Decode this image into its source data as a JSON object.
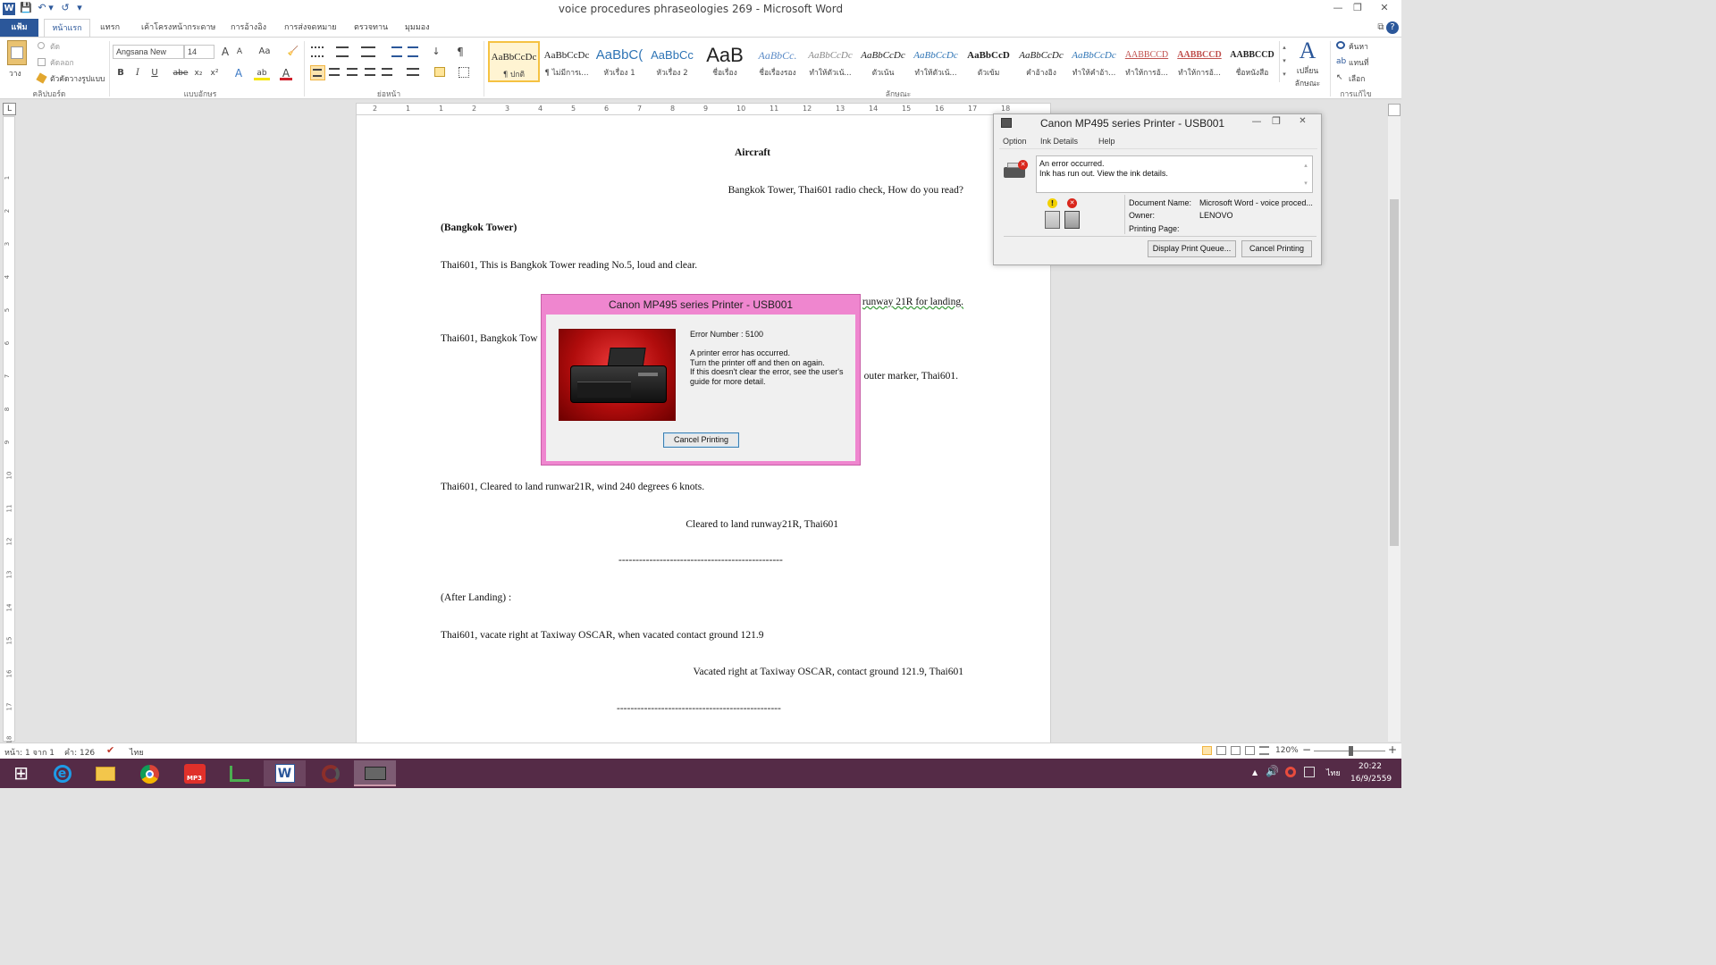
{
  "app": {
    "title": "voice procedures phraseologies 269 - Microsoft Word",
    "qat": {
      "word": "W",
      "save": "💾",
      "undo": "↶",
      "undo_dd": "▾",
      "redo": "↺",
      "customize": "▾"
    },
    "window_controls": {
      "help": "?",
      "restore_ribbon": "⧉",
      "minimize": "—",
      "maximize": "❐",
      "close": "✕"
    }
  },
  "tabs": [
    "แฟ้ม",
    "หน้าแรก",
    "แทรก",
    "เค้าโครงหน้ากระดาษ",
    "การอ้างอิง",
    "การส่งจดหมาย",
    "ตรวจทาน",
    "มุมมอง"
  ],
  "ribbon": {
    "clipboard": {
      "label": "คลิปบอร์ด",
      "paste": "วาง",
      "cut": "ตัด",
      "copy": "คัดลอก",
      "format_painter": "ตัวคัดวางรูปแบบ"
    },
    "font": {
      "label": "แบบอักษร",
      "font_name": "Angsana New",
      "font_size": "14",
      "grow": "A",
      "shrink": "A",
      "change_case": "Aa",
      "clear": "🧹",
      "bold": "B",
      "italic": "I",
      "underline": "U",
      "strike": "abe",
      "sub": "x₂",
      "sup": "x²",
      "effects": "A",
      "highlight": "ab",
      "color": "A"
    },
    "paragraph": {
      "label": "ย่อหน้า"
    },
    "styles": {
      "label": "ลักษณะ",
      "items": [
        {
          "preview": "AaBbCcDc",
          "name": "¶ ปกติ"
        },
        {
          "preview": "AaBbCcDc",
          "name": "¶ ไม่มีการเ..."
        },
        {
          "preview": "AaBbC(",
          "name": "หัวเรื่อง 1"
        },
        {
          "preview": "AaBbCc",
          "name": "หัวเรื่อง 2"
        },
        {
          "preview": "AaB",
          "name": "ชื่อเรื่อง"
        },
        {
          "preview": "AaBbCc.",
          "name": "ชื่อเรื่องรอง"
        },
        {
          "preview": "AaBbCcDc",
          "name": "ทำให้ตัวเน้..."
        },
        {
          "preview": "AaBbCcDc",
          "name": "ตัวเน้น"
        },
        {
          "preview": "AaBbCcDc",
          "name": "ทำให้ตัวเน้..."
        },
        {
          "preview": "AaBbCcD",
          "name": "ตัวเข้ม"
        },
        {
          "preview": "AaBbCcDc",
          "name": "คำอ้างอิง"
        },
        {
          "preview": "AaBbCcDc",
          "name": "ทำให้คำอ้า..."
        },
        {
          "preview": "AABBCCD",
          "name": "ทำให้การอ้..."
        },
        {
          "preview": "AABBCCD",
          "name": "ทำให้การอ้..."
        },
        {
          "preview": "AABBCCD",
          "name": "ชื่อหนังสือ"
        }
      ],
      "change_styles": "เปลี่ยน ลักษณะ",
      "change_styles_glyph": "A"
    },
    "editing": {
      "label": "การแก้ไข",
      "find": "ค้นหา",
      "replace": "แทนที่",
      "select": "เลือก"
    }
  },
  "ruler_numbers": [
    "2",
    "1",
    "1",
    "2",
    "3",
    "4",
    "5",
    "6",
    "7",
    "8",
    "9",
    "10",
    "11",
    "12",
    "13",
    "14",
    "15",
    "16",
    "17",
    "18"
  ],
  "vruler_numbers": [
    "1",
    "2",
    "3",
    "4",
    "5",
    "6",
    "7",
    "8",
    "9",
    "10",
    "11",
    "12",
    "13",
    "14",
    "15",
    "16",
    "17",
    "18",
    "19"
  ],
  "document": {
    "lines": [
      "Aircraft",
      "Bangkok  Tower,  Thai601  radio  check,  How  do  you  read?",
      "(Bangkok  Tower)",
      "Thai601,  This  is  Bangkok  Tower  reading  No.5,  loud  and  clear.",
      "runway  21R  for  landing.",
      "Thai601,  Bangkok  Tow",
      "outer  marker,  Thai601.",
      "Thai601,  Cleared  to  land  runwar21R,  wind  240  degrees  6  knots.",
      "Cleared  to  land  runway21R,  Thai601",
      "------------------------------------------------",
      "(After  Landing)  :",
      "Thai601,  vacate  right  at  Taxiway  OSCAR,  when  vacated  contact  ground  121.9",
      "Vacated  right  at  Taxiway  OSCAR,  contact  ground  121.9,  Thai601",
      "------------------------------------------------"
    ]
  },
  "printer_monitor": {
    "title": "Canon MP495 series Printer - USB001",
    "menu": [
      "Option",
      "Ink Details",
      "Help"
    ],
    "message_line1": "An error occurred.",
    "message_line2": "Ink has run out. View the ink details.",
    "document_name_label": "Document Name:",
    "document_name": "Microsoft Word - voice proced...",
    "owner_label": "Owner:",
    "owner": "LENOVO",
    "printing_page_label": "Printing Page:",
    "printing_page": "",
    "display_queue": "Display Print Queue...",
    "cancel": "Cancel Printing",
    "warn_mark": "!",
    "error_mark": "✕"
  },
  "printer_error": {
    "title": "Canon MP495 series Printer - USB001",
    "error_number": "Error Number : 5100",
    "message": [
      "A printer error has occurred.",
      "Turn the printer off and then on again.",
      "If this doesn't clear the error, see the user's",
      "guide for more detail."
    ],
    "cancel": "Cancel Printing"
  },
  "status": {
    "page": "หน้า: 1 จาก 1",
    "words": "คำ: 126",
    "proof": "✔",
    "language": "ไทย",
    "zoom": "120%",
    "zoom_minus": "−",
    "zoom_plus": "+"
  },
  "taskbar": {
    "start": "⊞",
    "mp3_label": "MP3",
    "word_label": "W",
    "tray_language": "ไทย",
    "time": "20:22",
    "date": "16/9/2559",
    "tray_up": "▲",
    "volume": "🔊"
  },
  "colors": {
    "accent": "#2b579a",
    "taskbar": "#552b47",
    "dialog_border": "#ef86cf",
    "error_red": "#d9261c"
  }
}
